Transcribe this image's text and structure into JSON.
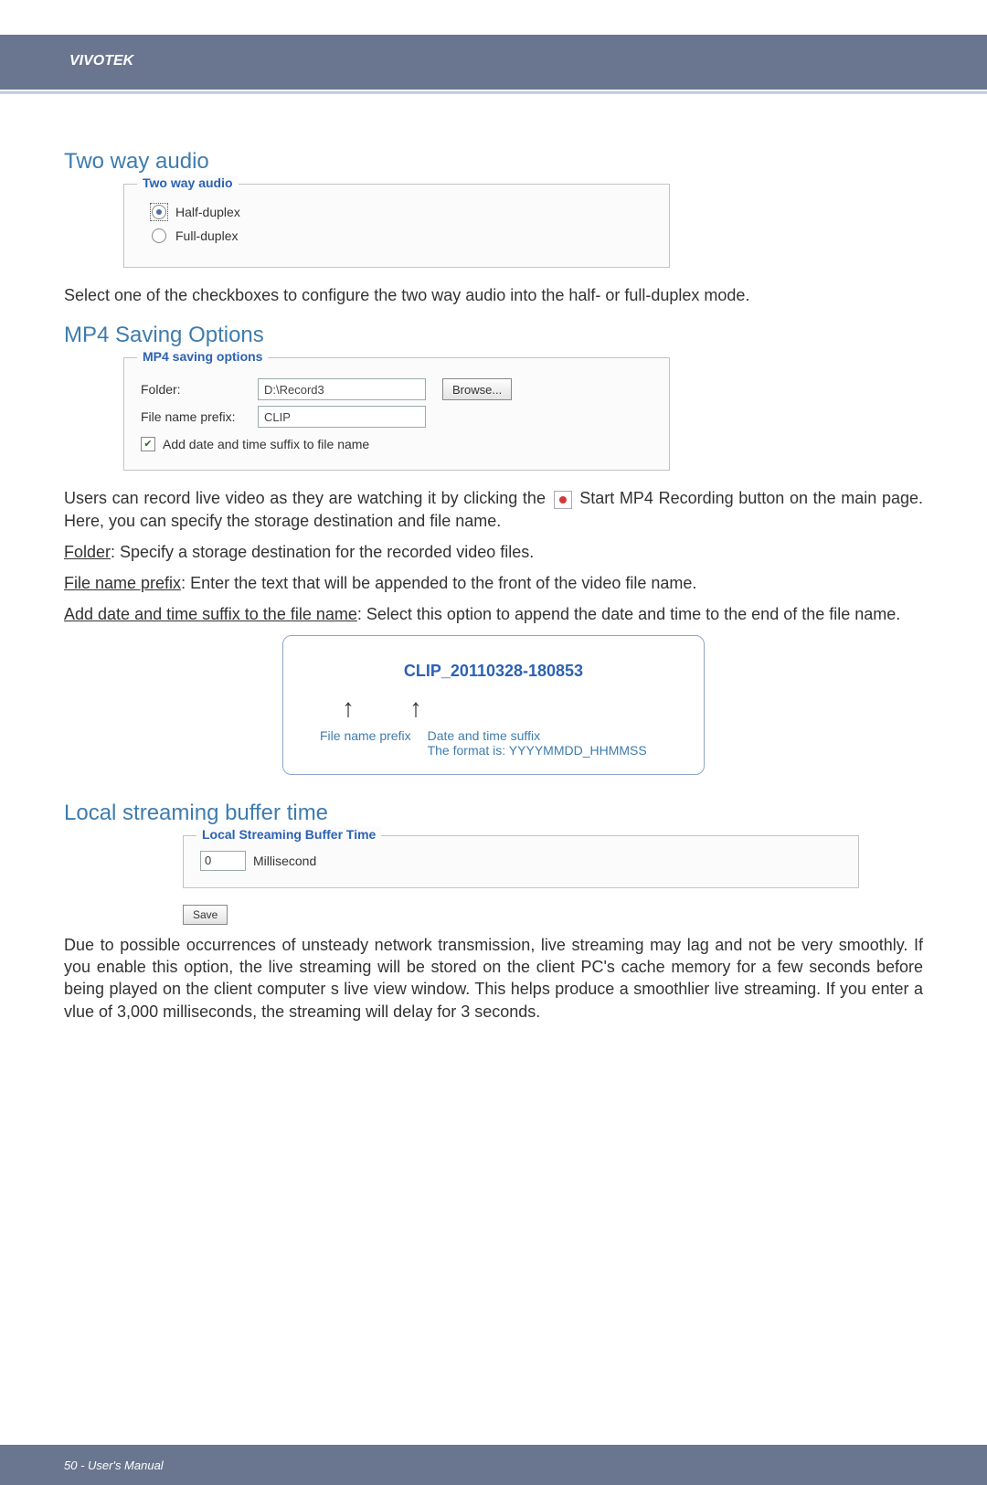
{
  "header": {
    "brand": "VIVOTEK"
  },
  "sections": {
    "two_way_audio": {
      "heading": "Two way audio",
      "legend": "Two way audio",
      "options": {
        "half": "Half-duplex",
        "full": "Full-duplex"
      },
      "note": "Select one of the checkboxes to configure the two way audio into the half- or full-duplex mode."
    },
    "mp4": {
      "heading": "MP4 Saving Options",
      "legend": "MP4 saving options",
      "folder_label": "Folder:",
      "folder_value": "D:\\Record3",
      "browse_label": "Browse...",
      "prefix_label": "File name prefix:",
      "prefix_value": "CLIP",
      "suffix_checkbox_label": "Add date and time suffix to file name",
      "para1_pre": "Users can record live video as they are watching it by clicking the ",
      "para1_post": " Start MP4 Recording  button on the main page. Here, you can specify the storage destination and file name.",
      "folder_desc_label": "Folder",
      "folder_desc_text": ": Specify a storage destination for the recorded video files.",
      "prefix_desc_label": "File name prefix",
      "prefix_desc_text": ": Enter the text that will be appended to the front of the video file name.",
      "suffix_desc_label": "Add date and time suffix to the file name",
      "suffix_desc_text": ": Select this option to append the date and time to the end of the file name.",
      "callout": {
        "filename": "CLIP_20110328-180853",
        "cap_prefix": "File name prefix",
        "cap_suffix_line1": "Date and time suffix",
        "cap_suffix_line2": "The format is: YYYYMMDD_HHMMSS"
      }
    },
    "buffer": {
      "heading": "Local streaming buffer time",
      "legend": "Local Streaming Buffer Time",
      "value": "0",
      "unit": "Millisecond",
      "save_label": "Save",
      "para": "Due to possible occurrences of unsteady network transmission, live streaming may lag and not be very smoothly. If you enable this option, the live streaming will be stored on the client PC's cache memory for a few seconds before being played on the client computer s live view window. This helps produce a smoothlier live streaming. If you enter a vlue of 3,000 milliseconds, the streaming will delay for 3 seconds."
    }
  },
  "footer": {
    "text": "50 - User's Manual"
  }
}
